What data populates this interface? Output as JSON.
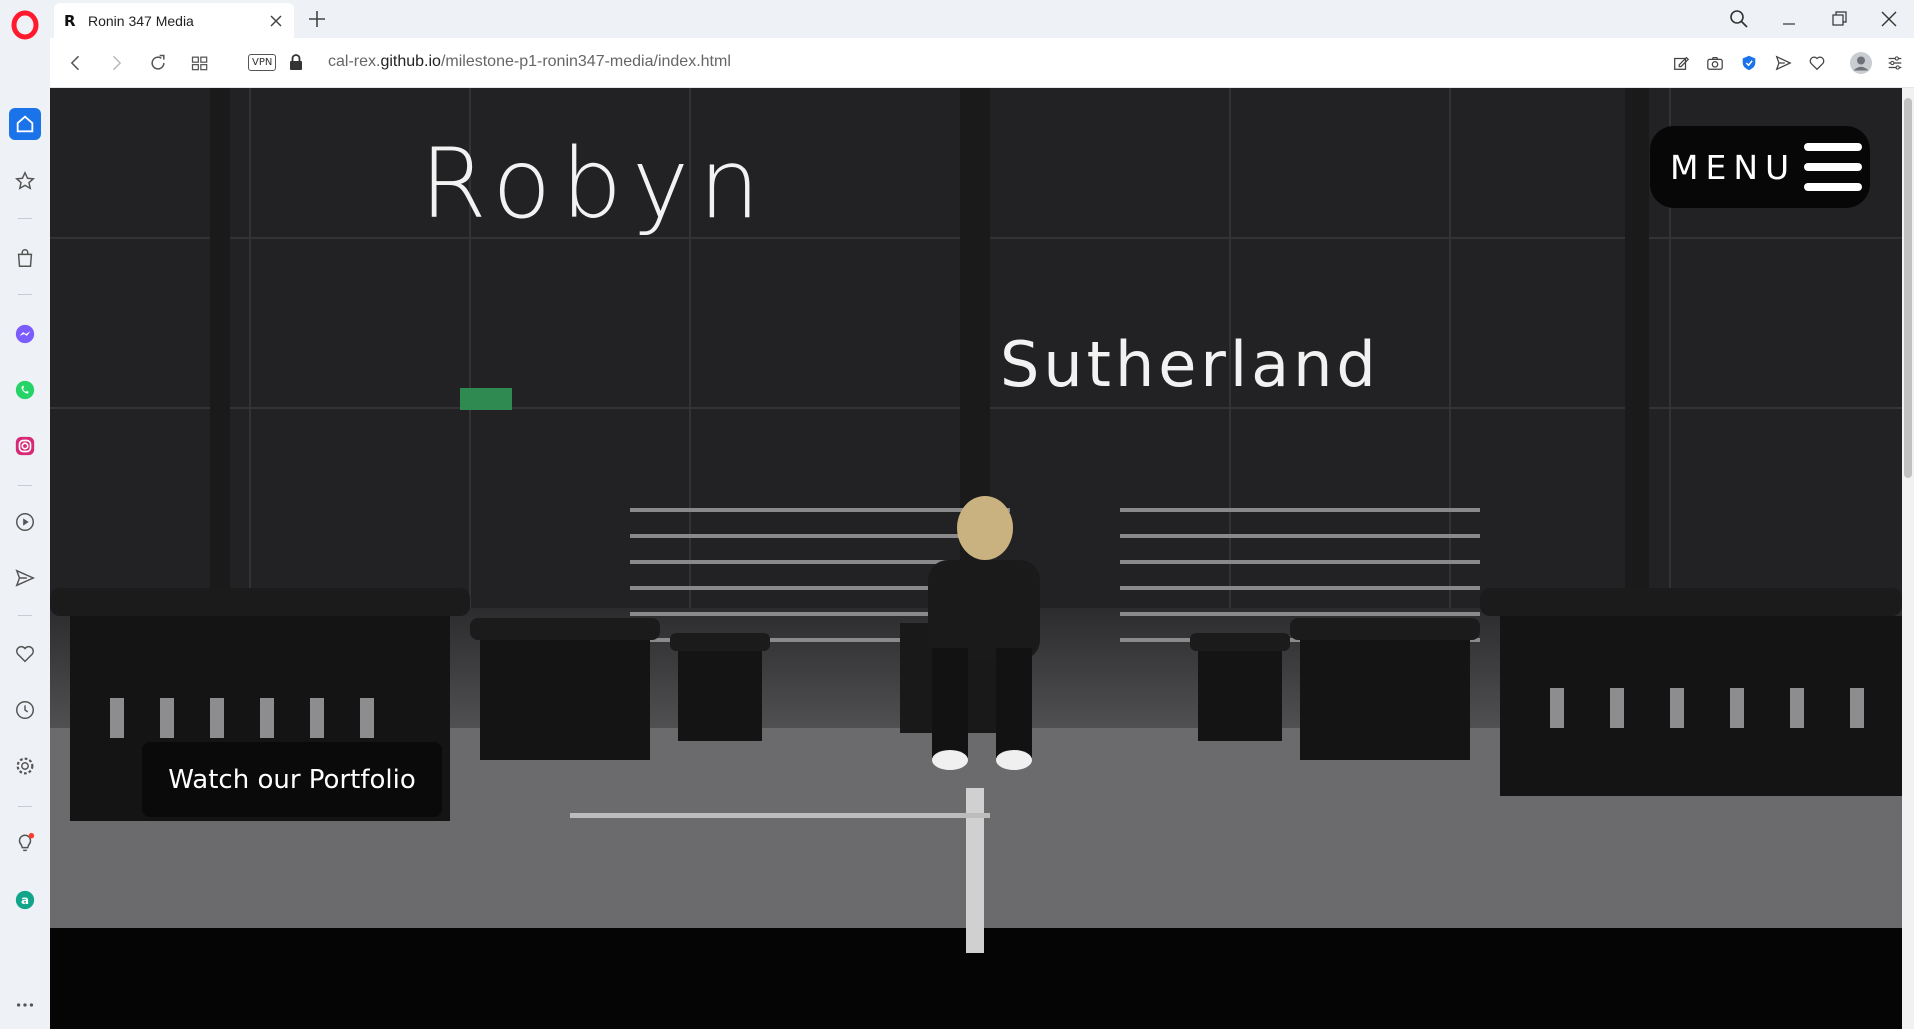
{
  "browser": {
    "tab": {
      "favicon": "R",
      "title": "Ronin 347 Media"
    },
    "address": {
      "vpn_label": "VPN",
      "url_prefix": "cal-rex.",
      "url_host": "github.io",
      "url_path": "/milestone-p1-ronin347-media/index.html"
    },
    "sidebar_icons": [
      "opera-logo",
      "home-icon",
      "star-icon",
      "shopping-bag-icon",
      "messenger-icon",
      "whatsapp-icon",
      "instagram-icon",
      "player-icon",
      "send-icon",
      "heart-icon",
      "clock-icon",
      "gear-icon",
      "lightbulb-icon",
      "aria-icon",
      "more-icon"
    ],
    "colors": {
      "accent": "#1a73e8",
      "opera_red": "#ff1b2d"
    }
  },
  "page": {
    "title_first": "Robyn",
    "title_last": "Sutherland",
    "menu_label": "MENU",
    "cta_label": "Watch our Portfolio"
  }
}
